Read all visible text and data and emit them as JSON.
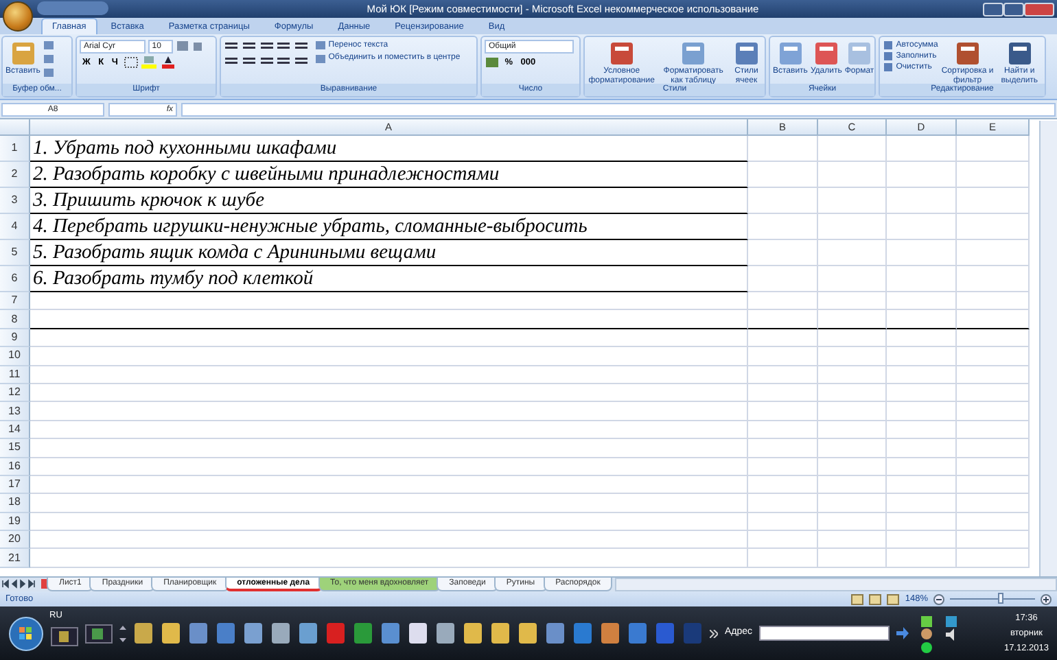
{
  "window": {
    "title": "Мой ЮК  [Режим совместимости] - Microsoft Excel некоммерческое использование"
  },
  "ribbon_tabs": [
    {
      "label": "Главная",
      "selected": true
    },
    {
      "label": "Вставка",
      "selected": false
    },
    {
      "label": "Разметка страницы",
      "selected": false
    },
    {
      "label": "Формулы",
      "selected": false
    },
    {
      "label": "Данные",
      "selected": false
    },
    {
      "label": "Рецензирование",
      "selected": false
    },
    {
      "label": "Вид",
      "selected": false
    }
  ],
  "ribbon": {
    "clipboard": {
      "paste": "Вставить",
      "label": "Буфер обм..."
    },
    "font": {
      "name": "Arial Cyr",
      "size": "10",
      "bold": "Ж",
      "italic": "К",
      "underline": "Ч",
      "label": "Шрифт"
    },
    "alignment": {
      "wrap": "Перенос текста",
      "merge": "Объединить и поместить в центре",
      "label": "Выравнивание"
    },
    "number": {
      "format": "Общий",
      "percent": "%",
      "thousands": "000",
      "label": "Число"
    },
    "styles": {
      "buttons": [
        "Условное форматирование",
        "Форматировать как таблицу",
        "Стили ячеек"
      ],
      "label": "Стили"
    },
    "cells": {
      "buttons": [
        "Вставить",
        "Удалить",
        "Формат"
      ],
      "label": "Ячейки"
    },
    "editing": {
      "small": [
        "Автосумма",
        "Заполнить",
        "Очистить"
      ],
      "buttons": [
        "Сортировка и фильтр",
        "Найти и выделить"
      ],
      "label": "Редактирование"
    }
  },
  "formula_bar": {
    "name_box": "A8",
    "fx": "fx"
  },
  "table": {
    "columns": [
      "A",
      "B",
      "C",
      "D",
      "E"
    ],
    "rows": [
      {
        "number": "1",
        "text": "1. Убрать под кухонными шкафами",
        "underlined": true
      },
      {
        "number": "2",
        "text": "2. Разобрать коробку с швейными принадлежностями",
        "underlined": true
      },
      {
        "number": "3",
        "text": "3. Пришить крючок к шубе",
        "underlined": true
      },
      {
        "number": "4",
        "text": "4. Перебрать игрушки-ненужные убрать, сломанные-выбросить",
        "underlined": true
      },
      {
        "number": "5",
        "text": "5. Разобрать ящик комда с Ариниными вещами",
        "underlined": true
      },
      {
        "number": "6",
        "text": "6. Разобрать тумбу под клеткой",
        "underlined": true
      },
      {
        "number": "7",
        "text": "",
        "underlined": false
      },
      {
        "number": "8",
        "text": "",
        "underlined": true
      },
      {
        "number": "9",
        "underlined": false
      },
      {
        "number": "10",
        "underlined": false
      },
      {
        "number": "11",
        "underlined": false
      },
      {
        "number": "12",
        "underlined": false
      },
      {
        "number": "13",
        "underlined": false
      },
      {
        "number": "14",
        "underlined": false
      },
      {
        "number": "15",
        "underlined": false
      },
      {
        "number": "16",
        "underlined": false
      },
      {
        "number": "17",
        "underlined": false
      },
      {
        "number": "18",
        "underlined": false
      },
      {
        "number": "19",
        "underlined": false
      },
      {
        "number": "20",
        "underlined": false
      },
      {
        "number": "21",
        "underlined": false
      }
    ]
  },
  "sheet_tabs": [
    {
      "label": "Лист1",
      "selected": false
    },
    {
      "label": "Праздники",
      "selected": false
    },
    {
      "label": "Планировщик",
      "selected": false
    },
    {
      "label": "отложенные дела",
      "selected": true,
      "color": "#e03030"
    },
    {
      "label": "То, что меня вдохновляет",
      "selected": false,
      "color": "#9ed27a"
    },
    {
      "label": "Заповеди",
      "selected": false
    },
    {
      "label": "Рутины",
      "selected": false
    },
    {
      "label": "Распорядок",
      "selected": false
    }
  ],
  "status_bar": {
    "text": "Готово",
    "zoom": "148%",
    "level": 0.6
  },
  "taskbar": {
    "language": "RU",
    "address_label": "Адрес",
    "time": "17:36",
    "day": "вторник",
    "date": "17.12.2013"
  }
}
